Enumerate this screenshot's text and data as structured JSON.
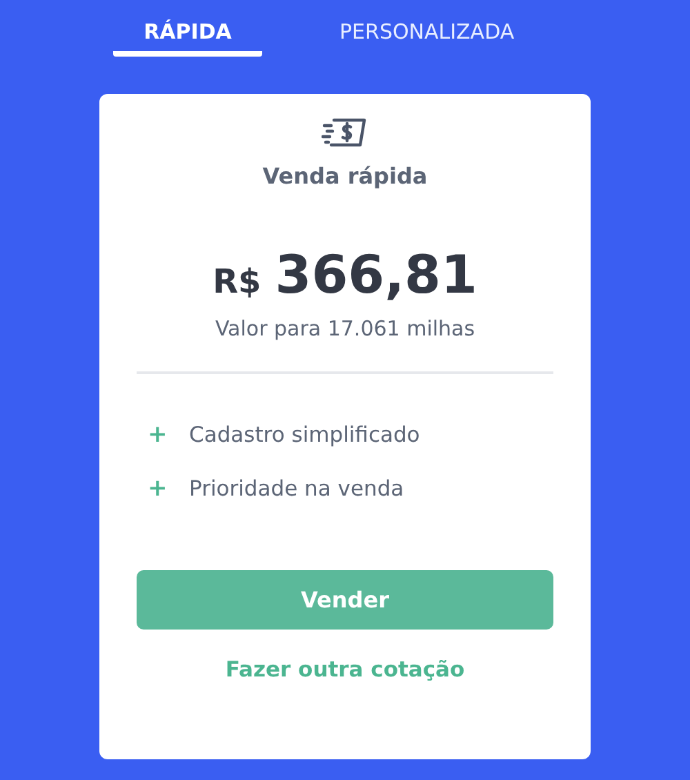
{
  "tabs": [
    {
      "label": "RÁPIDA",
      "selected": true
    },
    {
      "label": "PERSONALIZADA",
      "selected": false
    }
  ],
  "card": {
    "title": "Venda rápida",
    "currency": "R$",
    "amount": "366,81",
    "subtitle": "Valor para 17.061 milhas",
    "benefits": [
      {
        "mark": "+",
        "text": "Cadastro simplificado"
      },
      {
        "mark": "+",
        "text": "Prioridade na venda"
      }
    ],
    "primary_button": "Vender",
    "link": "Fazer outra cotação"
  }
}
